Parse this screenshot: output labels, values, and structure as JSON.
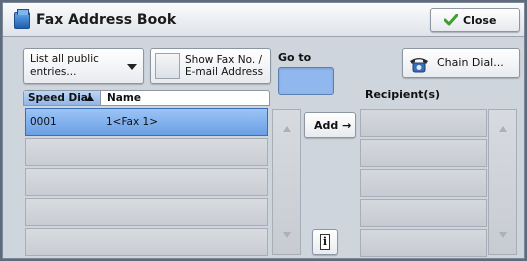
{
  "window": {
    "title": "Fax Address Book",
    "close_label": "Close"
  },
  "filter": {
    "dropdown_value": "List all public entries...",
    "show_fax_label": "Show Fax No. / E-mail Address"
  },
  "goto": {
    "label": "Go to",
    "value": ""
  },
  "chain_dial_label": "Chain Dial...",
  "recipients_label": "Recipient(s)",
  "list": {
    "columns": [
      "Speed Dial",
      "Name"
    ],
    "sort_column": "Speed Dial",
    "rows": [
      {
        "speed": "0001",
        "name": "1<Fax 1>",
        "selected": true
      },
      {
        "speed": "",
        "name": "",
        "selected": false
      },
      {
        "speed": "",
        "name": "",
        "selected": false
      },
      {
        "speed": "",
        "name": "",
        "selected": false
      },
      {
        "speed": "",
        "name": "",
        "selected": false
      }
    ]
  },
  "add_label": "Add →",
  "info_glyph": "i",
  "colors": {
    "selected_row": "#7aaaea",
    "goto_field": "#90b8ee",
    "panel": "#cfd5dc"
  },
  "icons": [
    "folder-icon",
    "checkmark-icon",
    "dropdown-arrow-icon",
    "telephone-icon",
    "sort-ascending-icon",
    "scroll-up-icon",
    "scroll-down-icon",
    "info-icon"
  ]
}
